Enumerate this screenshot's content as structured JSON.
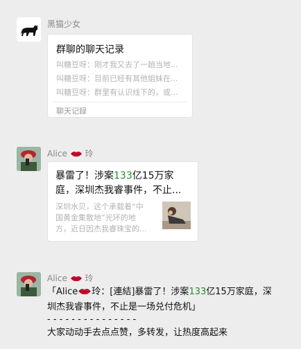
{
  "messages": [
    {
      "sender": "黑猫少女",
      "card": {
        "title": "群聊的聊天记录",
        "lines": [
          "叫糖豆呀：刚才我又去了一趟当地...",
          "叫糖豆呀：目前已经有其他姐妹在...",
          "叫糖豆呀：群里有认识线下的，或..."
        ],
        "footer": "聊天记録"
      }
    },
    {
      "sender_name": "Alice",
      "sender_suffix": "玲",
      "link": {
        "title_prefix": "暴雷了！涉案",
        "title_number": "133",
        "title_rest": "亿15万家",
        "title_line2": "庭，深圳杰我睿事件，不止...",
        "desc_line1": "深圳水贝，这个承载着“中",
        "desc_line2": "国黄金集散地”光环的地",
        "desc_line3": "方，近日因杰我睿珠宝的..."
      }
    },
    {
      "sender_name": "Alice",
      "sender_suffix": "玲",
      "text": {
        "open_bracket": "「",
        "name": "Alice",
        "name_suffix": "玲：[連結]暴雷了！涉案",
        "number": "133",
        "rest_line1": "亿15万家庭，深",
        "line2": "圳杰我睿事件，不止是一场兑付危机」",
        "separator": "- - - - - - - - - - - - - - -",
        "line4": "大家动动手去点点赞，多转发，让热度高起来"
      }
    }
  ],
  "colors": {
    "background": "#ededed",
    "number_highlight": "#2a8a2a",
    "lips": "#c8102e"
  },
  "icons": [
    "black-cat-avatar-icon",
    "lips-emoji-icon",
    "alice-avatar-icon"
  ]
}
